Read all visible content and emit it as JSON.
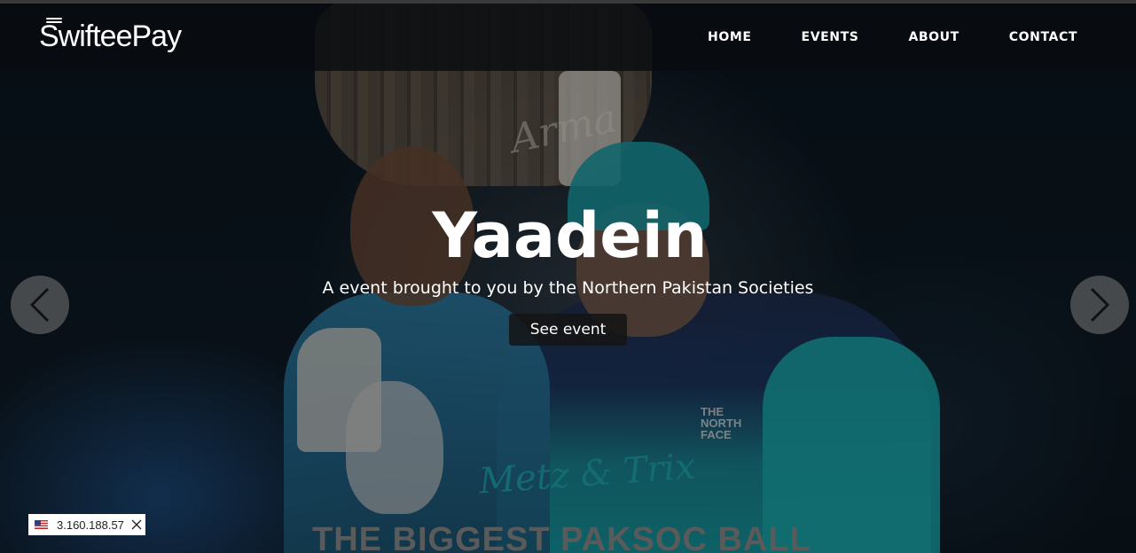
{
  "brand": {
    "logo_text": "SwifteePay"
  },
  "nav": {
    "items": [
      {
        "label": "HOME"
      },
      {
        "label": "EVENTS"
      },
      {
        "label": "ABOUT"
      },
      {
        "label": "CONTACT"
      }
    ]
  },
  "hero": {
    "title": "Yaadein",
    "subtitle": "A event brought to you by the Northern Pakistan Societies",
    "button_label": "See event",
    "poster": {
      "signature_text": "Arma",
      "artists_text": "Metz & Trix",
      "headline_text": "THE BIGGEST PAKSOC BALL",
      "badge_text": "THE NORTH FACE"
    }
  },
  "carousel": {
    "prev_icon": "chevron-left-icon",
    "next_icon": "chevron-right-icon"
  },
  "ip_badge": {
    "flag_icon": "us-flag-icon",
    "ip": "3.160.188.57",
    "close_icon": "close-icon"
  },
  "colors": {
    "navbar_bg": "#080c10",
    "button_bg": "#141414",
    "arrow_bg": "#787878",
    "text": "#ffffff"
  }
}
